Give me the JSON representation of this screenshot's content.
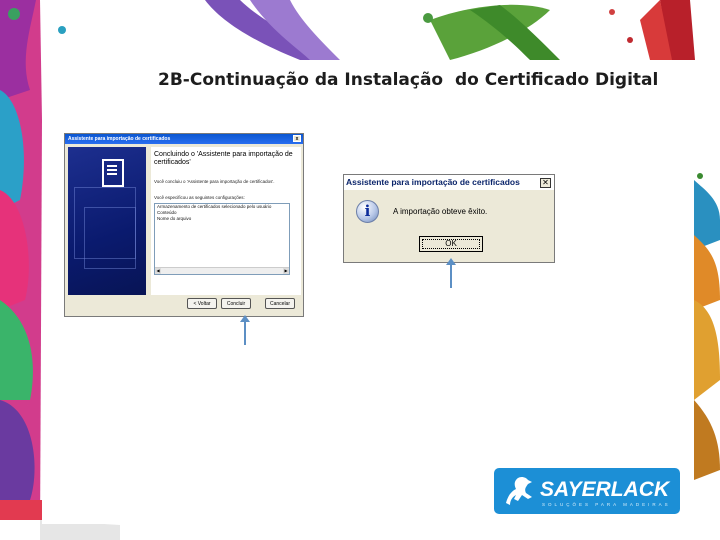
{
  "slide": {
    "title": "2B-Continuação da Instalação  do Certificado Digital"
  },
  "wizard": {
    "window_title": "Assistente para importação de certificados",
    "heading": "Concluindo o 'Assistente para importação de certificados'",
    "intro_text": "Você concluiu o 'Assistente para importação de certificados'.",
    "settings_text": "Você especificou as seguintes configurações:",
    "settings_rows": [
      "Armazenamento de certificados selecionado pelo usuário",
      "Conteúdo",
      "Nome do arquivo"
    ],
    "buttons": {
      "back": "< Voltar",
      "finish": "Concluir",
      "cancel": "Cancelar"
    }
  },
  "message_box": {
    "window_title": "Assistente para importação de certificados",
    "close_glyph": "✕",
    "icon": "info-icon",
    "message": "A importação obteve êxito.",
    "ok_label": "OK"
  },
  "logo": {
    "brand": "SAYERLACK",
    "tagline": "SOLUÇÕES PARA MADEIRAS"
  },
  "colors": {
    "arrow": "#5c8fc4",
    "logo_bg": "#1c8fd6",
    "titlebar_blue": "#0b57d0"
  }
}
